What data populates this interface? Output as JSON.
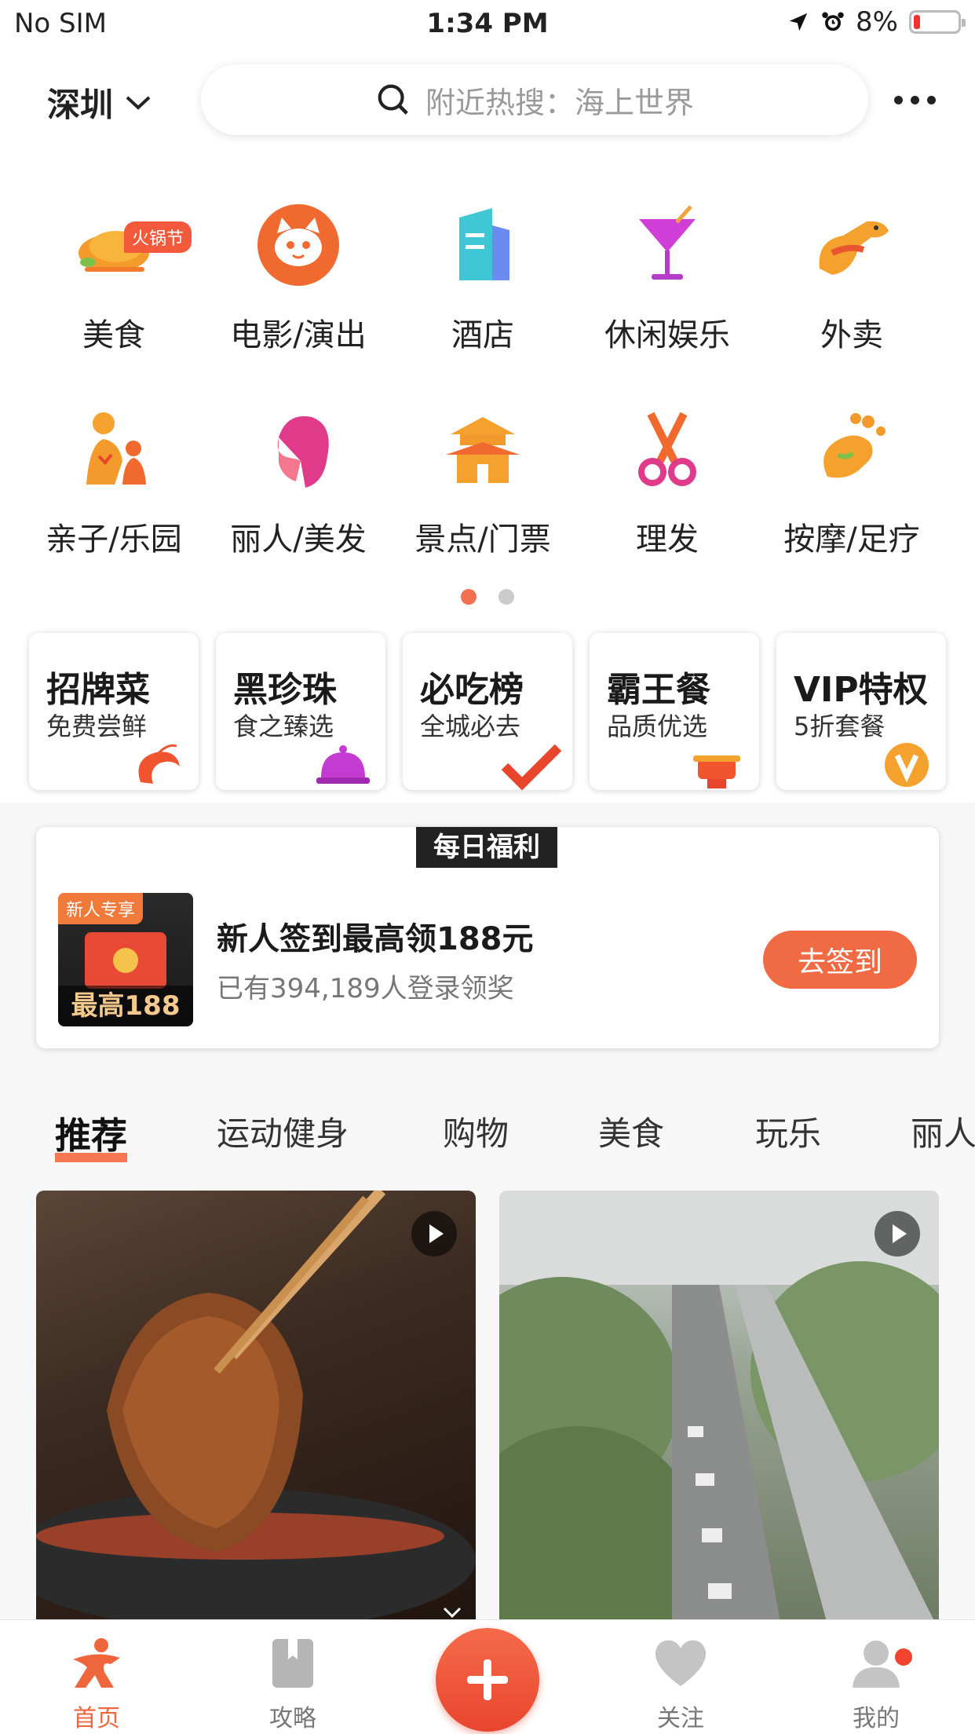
{
  "status_bar": {
    "carrier": "No SIM",
    "time": "1:34 PM",
    "battery": "8%"
  },
  "header": {
    "city": "深圳",
    "search_placeholder": "附近热搜：海上世界"
  },
  "categories": [
    {
      "label": "美食",
      "icon": "chicken-icon",
      "badge": "火锅节"
    },
    {
      "label": "电影/演出",
      "icon": "cat-face-icon"
    },
    {
      "label": "酒店",
      "icon": "building-icon"
    },
    {
      "label": "休闲娱乐",
      "icon": "cocktail-icon"
    },
    {
      "label": "外卖",
      "icon": "kangaroo-icon"
    },
    {
      "label": "亲子/乐园",
      "icon": "parent-child-icon"
    },
    {
      "label": "丽人/美发",
      "icon": "woman-hair-icon"
    },
    {
      "label": "景点/门票",
      "icon": "pagoda-icon"
    },
    {
      "label": "理发",
      "icon": "scissors-icon"
    },
    {
      "label": "按摩/足疗",
      "icon": "foot-icon"
    }
  ],
  "page_indicator": {
    "count": 2,
    "active": 0
  },
  "specials": [
    {
      "title": "招牌菜",
      "subtitle": "免费尝鲜",
      "icon": "shrimp-icon"
    },
    {
      "title": "黑珍珠",
      "subtitle": "食之臻选",
      "icon": "dish-cover-icon"
    },
    {
      "title": "必吃榜",
      "subtitle": "全城必去",
      "icon": "check-icon"
    },
    {
      "title": "霸王餐",
      "subtitle": "品质优选",
      "icon": "hotpot-icon"
    },
    {
      "title": "VIP特权",
      "subtitle": "5折套餐",
      "icon": "vip-v-icon"
    }
  ],
  "welfare": {
    "tag": "每日福利",
    "image_badge": "新人专享",
    "image_caption": "最高188",
    "title": "新人签到最高领188元",
    "subtitle": "已有394,189人登录领奖",
    "button": "去签到"
  },
  "feed_tabs": [
    "推荐",
    "运动健身",
    "购物",
    "美食",
    "玩乐",
    "丽人"
  ],
  "tab_bar": [
    {
      "label": "首页",
      "icon": "home-person-icon",
      "active": true
    },
    {
      "label": "攻略",
      "icon": "bookmark-icon"
    },
    {
      "label": "",
      "icon": "plus-icon"
    },
    {
      "label": "关注",
      "icon": "heart-icon"
    },
    {
      "label": "我的",
      "icon": "profile-icon"
    }
  ],
  "colors": {
    "accent": "#f0663c",
    "badge": "#f25a3b"
  }
}
